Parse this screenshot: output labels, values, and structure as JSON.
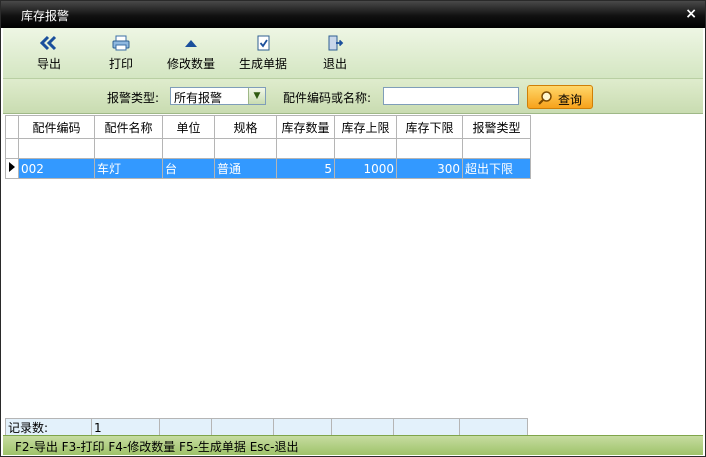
{
  "window": {
    "title": "库存报警",
    "close_glyph": "×"
  },
  "toolbar": [
    {
      "name": "export-button",
      "icon": "double-chevron-left-icon",
      "label": "导出"
    },
    {
      "name": "print-button",
      "icon": "printer-icon",
      "label": "打印"
    },
    {
      "name": "modify-quantity-button",
      "icon": "triangle-up-icon",
      "label": "修改数量"
    },
    {
      "name": "generate-document-button",
      "icon": "document-check-icon",
      "label": "生成单据"
    },
    {
      "name": "exit-button",
      "icon": "exit-door-icon",
      "label": "退出"
    }
  ],
  "filter": {
    "type_label": "报警类型:",
    "type_value": "所有报警",
    "search_label": "配件编码或名称:",
    "search_value": "",
    "query_label": "查询"
  },
  "grid": {
    "columns": [
      "配件编码",
      "配件名称",
      "单位",
      "规格",
      "库存数量",
      "库存上限",
      "库存下限",
      "报警类型"
    ],
    "rows": [
      {
        "code": "002",
        "name": "车灯",
        "unit": "台",
        "spec": "普通",
        "qty": "5",
        "upper": "1000",
        "lower": "300",
        "alarm": "超出下限"
      }
    ]
  },
  "footer": {
    "label": "记录数:",
    "count": "1"
  },
  "status": {
    "text": "F2-导出 F3-打印 F4-修改数量 F5-生成单据 Esc-退出"
  },
  "colors": {
    "selection": "#3399ff",
    "toolbar": "#d4e6c2",
    "status": "#9fc36a",
    "query_button": "#f7a21b"
  }
}
